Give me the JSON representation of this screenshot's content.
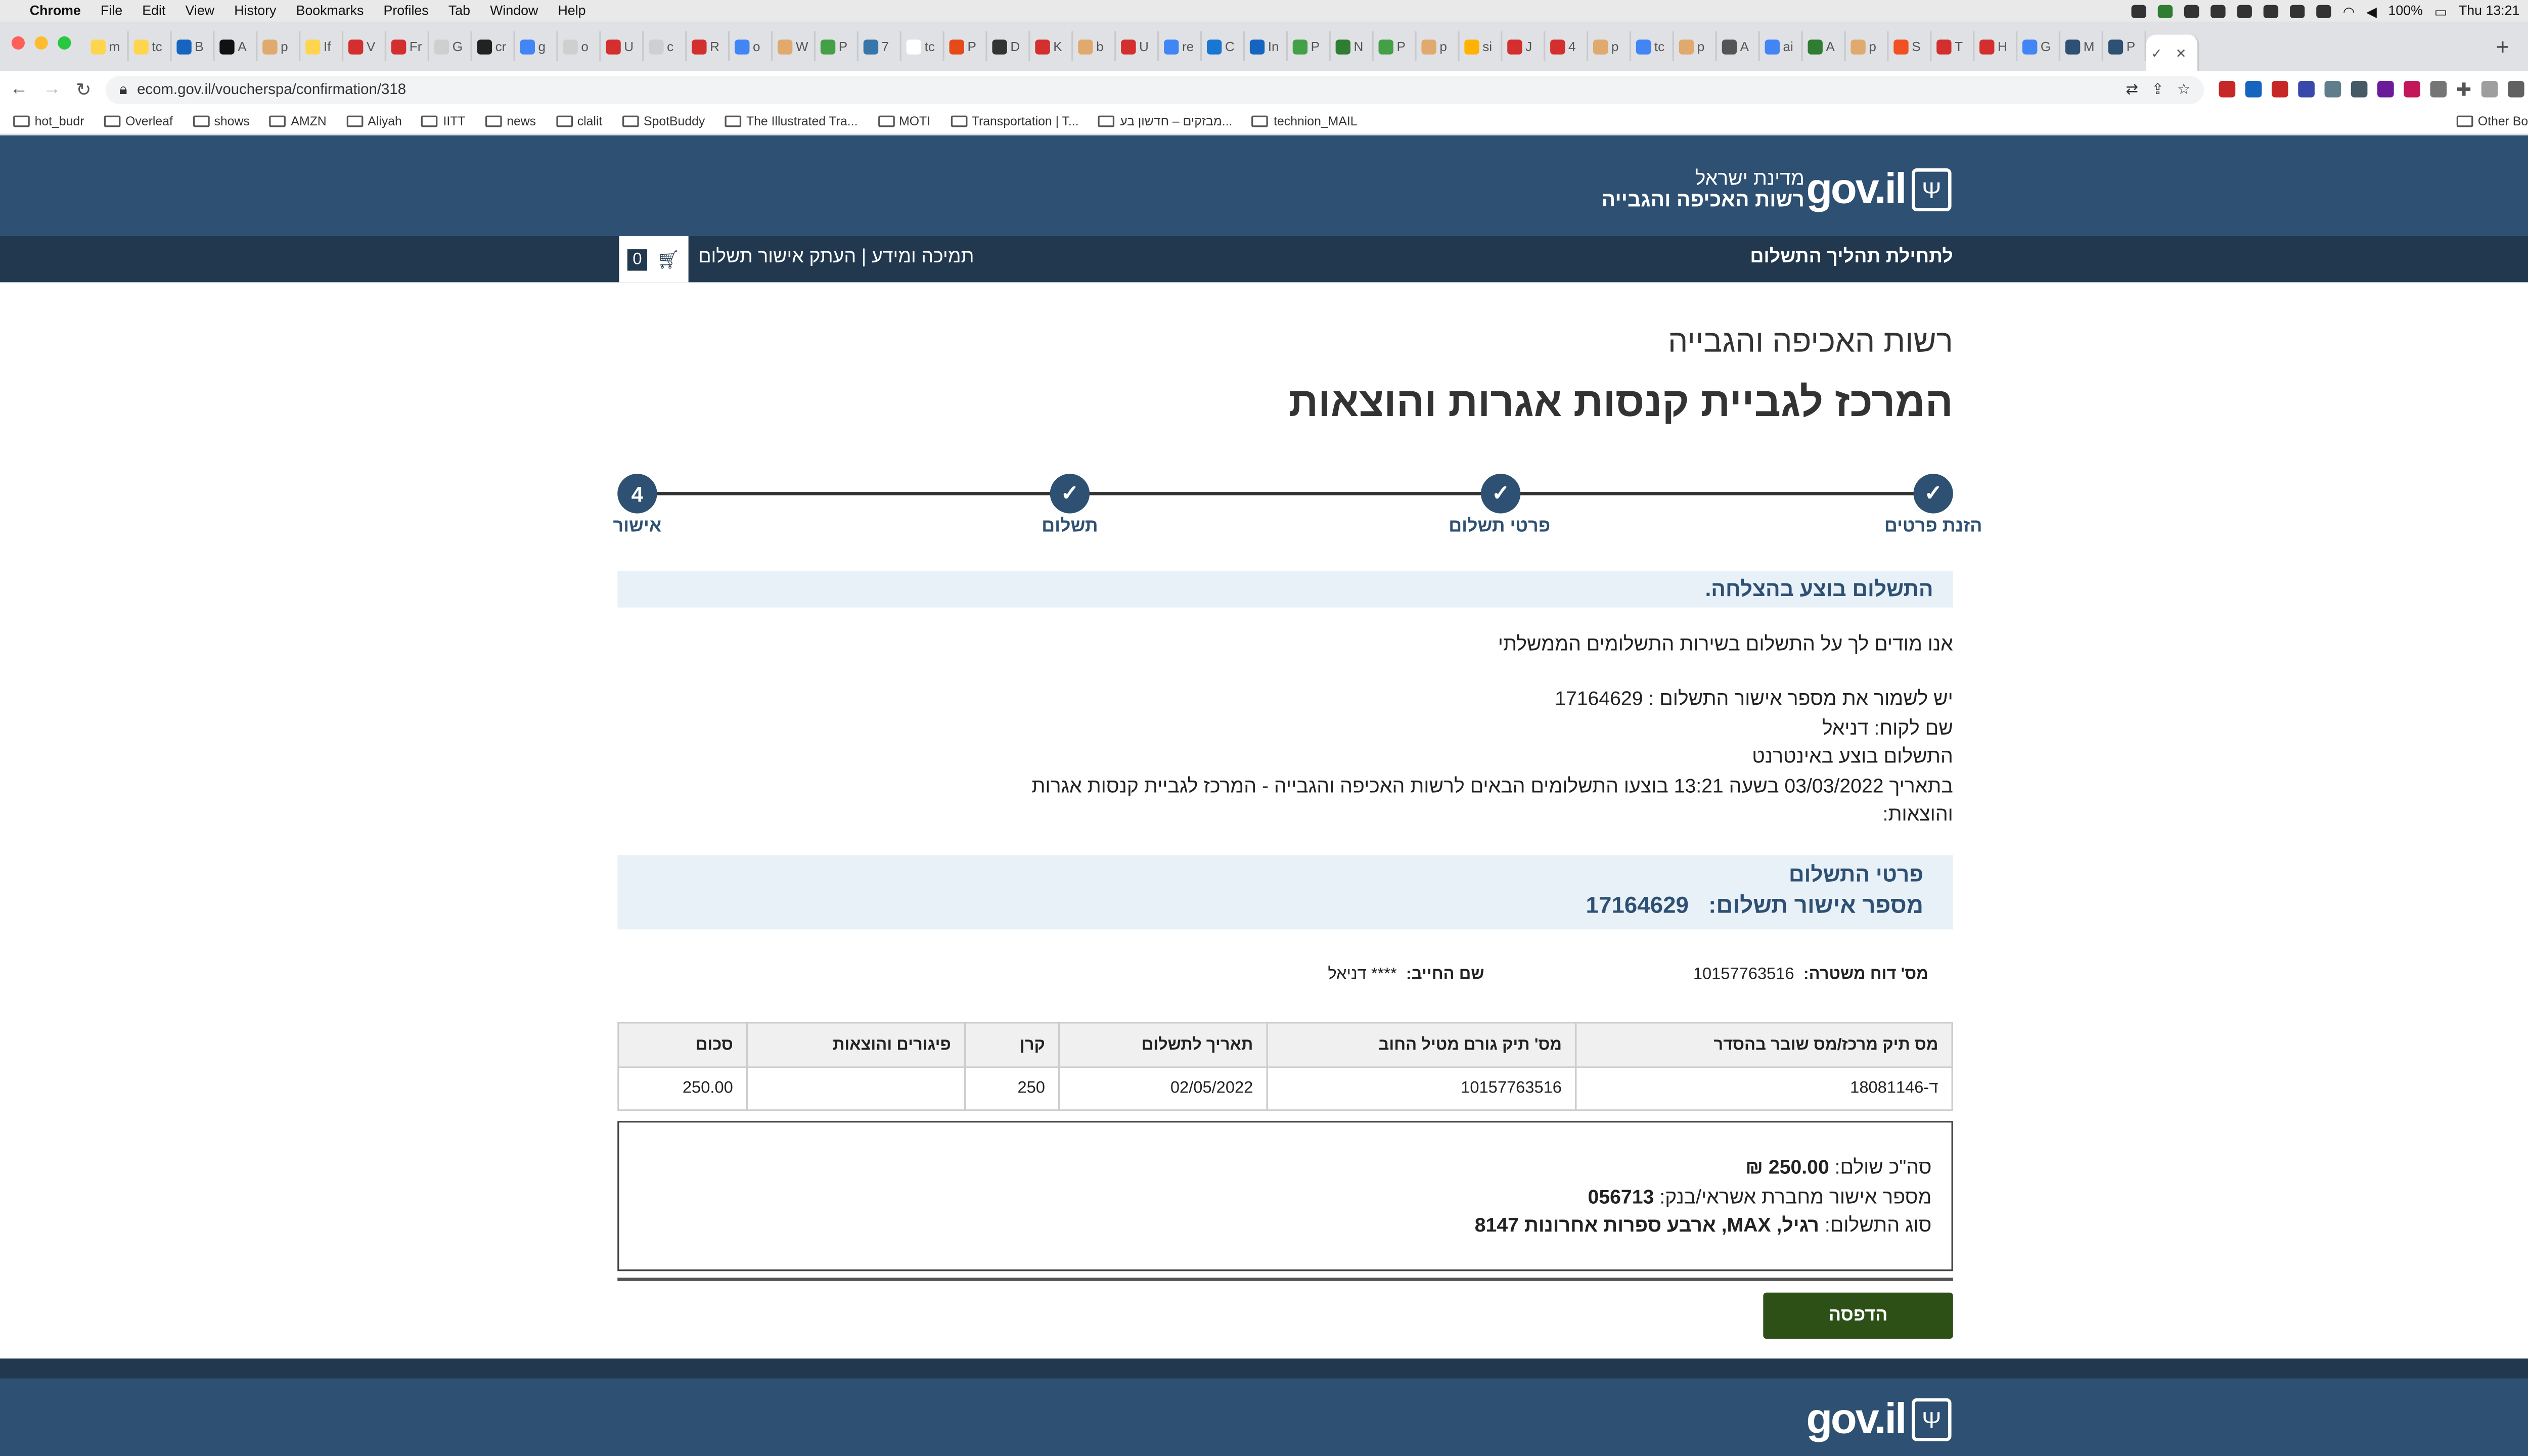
{
  "os_menu": {
    "app": "Chrome",
    "items": [
      "File",
      "Edit",
      "View",
      "History",
      "Bookmarks",
      "Profiles",
      "Tab",
      "Window",
      "Help"
    ],
    "battery": "100%",
    "clock": "Thu 13:21"
  },
  "browser": {
    "tabs": [
      {
        "label": "m",
        "color": "#ffd54f"
      },
      {
        "label": "tc",
        "color": "#ffd54f"
      },
      {
        "label": "B",
        "color": "#1565c0"
      },
      {
        "label": "A",
        "color": "#111111"
      },
      {
        "label": "p",
        "color": "#e0a96d"
      },
      {
        "label": "If",
        "color": "#ffd54f"
      },
      {
        "label": "V",
        "color": "#d32f2f"
      },
      {
        "label": "Fr",
        "color": "#d32f2f"
      },
      {
        "label": "G",
        "color": "#cfcfcf"
      },
      {
        "label": "cr",
        "color": "#222222"
      },
      {
        "label": "g",
        "color": "#4285f4"
      },
      {
        "label": "o",
        "color": "#cfcfcf"
      },
      {
        "label": "U",
        "color": "#d32f2f"
      },
      {
        "label": "c",
        "color": "#cfcfcf"
      },
      {
        "label": "R",
        "color": "#d32f2f"
      },
      {
        "label": "o",
        "color": "#4285f4"
      },
      {
        "label": "W",
        "color": "#e0a96d"
      },
      {
        "label": "P",
        "color": "#43a047"
      },
      {
        "label": "7",
        "color": "#3776ab"
      },
      {
        "label": "tc",
        "color": "#ffffff"
      },
      {
        "label": "P",
        "color": "#e64a19"
      },
      {
        "label": "D",
        "color": "#333333"
      },
      {
        "label": "K",
        "color": "#d32f2f"
      },
      {
        "label": "b",
        "color": "#e0a96d"
      },
      {
        "label": "U",
        "color": "#d32f2f"
      },
      {
        "label": "re",
        "color": "#4285f4"
      },
      {
        "label": "C",
        "color": "#1976d2"
      },
      {
        "label": "In",
        "color": "#1565c0"
      },
      {
        "label": "P",
        "color": "#43a047"
      },
      {
        "label": "N",
        "color": "#2e7d32"
      },
      {
        "label": "P",
        "color": "#43a047"
      },
      {
        "label": "p",
        "color": "#e0a96d"
      },
      {
        "label": "si",
        "color": "#ffb300"
      },
      {
        "label": "J",
        "color": "#d32f2f"
      },
      {
        "label": "4",
        "color": "#d32f2f"
      },
      {
        "label": "p",
        "color": "#e0a96d"
      },
      {
        "label": "tc",
        "color": "#4285f4"
      },
      {
        "label": "p",
        "color": "#e0a96d"
      },
      {
        "label": "A",
        "color": "#555555"
      },
      {
        "label": "ai",
        "color": "#4285f4"
      },
      {
        "label": "A",
        "color": "#2e7d32"
      },
      {
        "label": "p",
        "color": "#e0a96d"
      },
      {
        "label": "S",
        "color": "#f25022"
      },
      {
        "label": "T",
        "color": "#d32f2f"
      },
      {
        "label": "H",
        "color": "#d32f2f"
      },
      {
        "label": "G",
        "color": "#4285f4"
      },
      {
        "label": "M",
        "color": "#2e5072"
      },
      {
        "label": "P",
        "color": "#2e5072"
      }
    ],
    "active_tab_label": "✓",
    "url": "ecom.gov.il/voucherspa/confirmation/318",
    "bookmarks": [
      "hot_budr",
      "Overleaf",
      "shows",
      "AMZN",
      "Aliyah",
      "IITT",
      "news",
      "clalit",
      "SpotBuddy",
      "The Illustrated Tra...",
      "MOTI",
      "Transportation | T...",
      "מבזקים – חדשון בע...",
      "technion_MAIL"
    ],
    "other_bookmarks": "Other Bookmarks"
  },
  "header": {
    "logo_text": "gov.il",
    "org_line1": "מדינת ישראל",
    "org_line2": "רשות האכיפה והגבייה"
  },
  "nav": {
    "start": "לתחילת תהליך התשלום",
    "support": "תמיכה ומידע | העתק אישור תשלום",
    "cart_count": "0"
  },
  "page": {
    "authority": "רשות האכיפה והגבייה",
    "center": "המרכז לגביית קנסות אגרות והוצאות"
  },
  "steps": [
    {
      "label": "הזנת פרטים",
      "mark": "✓"
    },
    {
      "label": "פרטי תשלום",
      "mark": "✓"
    },
    {
      "label": "תשלום",
      "mark": "✓"
    },
    {
      "label": "אישור",
      "mark": "4"
    }
  ],
  "success": "התשלום בוצע בהצלחה.",
  "info": {
    "thanks": "אנו מודים לך על התשלום בשירות התשלומים הממשלתי",
    "save_note": "יש לשמור את מספר אישור התשלום : 17164629",
    "customer": "שם לקוח: דניאל",
    "via": "התשלום בוצע באינטרנט",
    "date_line": "בתאריך 03/03/2022 בשעה 13:21 בוצעו התשלומים הבאים לרשות האכיפה והגבייה - המרכז לגביית קנסות אגרות",
    "date_line_cont": "והוצאות:"
  },
  "details": {
    "title": "פרטי התשלום",
    "conf_label": "מספר אישור תשלום:",
    "conf_number": "17164629"
  },
  "meta": {
    "report_label": "מס' דוח משטרה:",
    "report_value": "10157763516",
    "debtor_label": "שם החייב:",
    "debtor_value": "**** דניאל"
  },
  "table": {
    "headers": [
      "מס תיק מרכז/מס שובר בהסדר",
      "מס' תיק גורם מטיל החוב",
      "תאריך לתשלום",
      "קרן",
      "פיגורים והוצאות",
      "סכום"
    ],
    "rows": [
      [
        "ד-18081146",
        "10157763516",
        "02/05/2022",
        "250",
        "",
        "250.00"
      ]
    ]
  },
  "summary": {
    "total_label": "סה\"כ שולם:",
    "total_value": "250.00 ₪",
    "credit_label": "מספר אישור מחברת אשראי/בנק:",
    "credit_value": "056713",
    "type_label": "סוג התשלום:",
    "type_value": "רגיל, MAX, ארבע ספרות אחרונות 8147"
  },
  "print_button": "הדפסה"
}
